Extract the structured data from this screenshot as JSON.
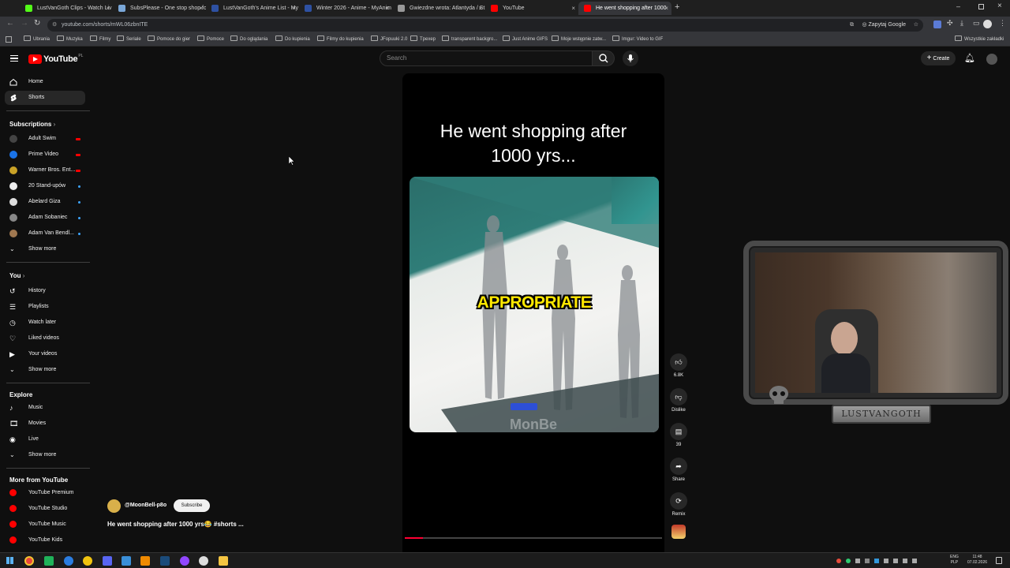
{
  "browser": {
    "tabs": [
      {
        "title": "LustVanGoth Clips - Watch Liv",
        "color": "#53fc18",
        "active": false
      },
      {
        "title": "SubsPlease - One stop shop fo",
        "color": "#7aa7d8",
        "active": false
      },
      {
        "title": "LustVanGoth's Anime List - My",
        "color": "#2e51a2",
        "active": false
      },
      {
        "title": "Winter 2026 - Anime - MyAnim",
        "color": "#2e51a2",
        "active": false
      },
      {
        "title": "Gwiezdne wrota: Atlantyda / St",
        "color": "#999999",
        "active": false
      },
      {
        "title": "YouTube",
        "color": "#ff0000",
        "active": false
      },
      {
        "title": "He went shopping after 1000",
        "color": "#ff0000",
        "active": true
      }
    ],
    "url": "youtube.com/shorts/mWL06zbnITE",
    "ask_google": "Zapytaj Google",
    "bookmarks": [
      "Ubrania",
      "Muzyka",
      "Filmy",
      "Seriale",
      "Pomoce do gier",
      "Pomoce",
      "Do oglądania",
      "Do kupienia",
      "Filmy do kupienia",
      "JFopuuki 2.0",
      "Tpexep",
      "transparent backgro...",
      "Just Anime GIFS",
      "Moje wstępnie zatw...",
      "Imgur: Video to GIF"
    ],
    "all_bookmarks": "Wszystkie zakładki"
  },
  "youtube": {
    "logo_text": "YouTube",
    "country": "PL",
    "search_placeholder": "Search",
    "create_label": "Create",
    "nav": [
      {
        "label": "Home",
        "icon": "home-icon"
      },
      {
        "label": "Shorts",
        "icon": "shorts-icon",
        "active": true
      }
    ],
    "subscriptions_title": "Subscriptions",
    "subscriptions": [
      {
        "label": "Adult Swim",
        "color": "#444444",
        "live": true
      },
      {
        "label": "Prime Video",
        "color": "#1a73e8",
        "live": true
      },
      {
        "label": "Warner Bros. Ent...",
        "color": "#c9a227",
        "live": true
      },
      {
        "label": "20 Stand-upów",
        "color": "#eeeeee",
        "live": false
      },
      {
        "label": "Abelard Giza",
        "color": "#dddddd",
        "live": false
      },
      {
        "label": "Adam Sobaniec",
        "color": "#888888",
        "live": false
      },
      {
        "label": "Adam Van Bendl...",
        "color": "#a07850",
        "live": false
      }
    ],
    "show_more": "Show more",
    "you_title": "You",
    "you_items": [
      "History",
      "Playlists",
      "Watch later",
      "Liked videos",
      "Your videos"
    ],
    "explore_title": "Explore",
    "explore_items": [
      "Music",
      "Movies",
      "Live"
    ],
    "more_title": "More from YouTube",
    "more_items": [
      "YouTube Premium",
      "YouTube Studio",
      "YouTube Music",
      "YouTube Kids"
    ],
    "short": {
      "title_line1": "He went shopping after",
      "title_line2": "1000 yrs...",
      "caption": "APPROPRIATE",
      "watermark": "MonBe",
      "channel": "@MoonBell-p8o",
      "subscribe": "Subscribe",
      "video_title": "He went shopping after 1000 yrs😂 #shorts ...",
      "progress": 0.07
    },
    "actions": [
      {
        "name": "like",
        "label": "6.8K"
      },
      {
        "name": "dislike",
        "label": "Dislike"
      },
      {
        "name": "comments",
        "label": "39"
      },
      {
        "name": "share",
        "label": "Share"
      },
      {
        "name": "remix",
        "label": "Remix"
      }
    ]
  },
  "webcam": {
    "name_plate": "LUSTVANGOTH"
  },
  "taskbar": {
    "lang1": "ENG",
    "lang2": "PLP",
    "time": "11:48",
    "date": "07.02.2026"
  }
}
